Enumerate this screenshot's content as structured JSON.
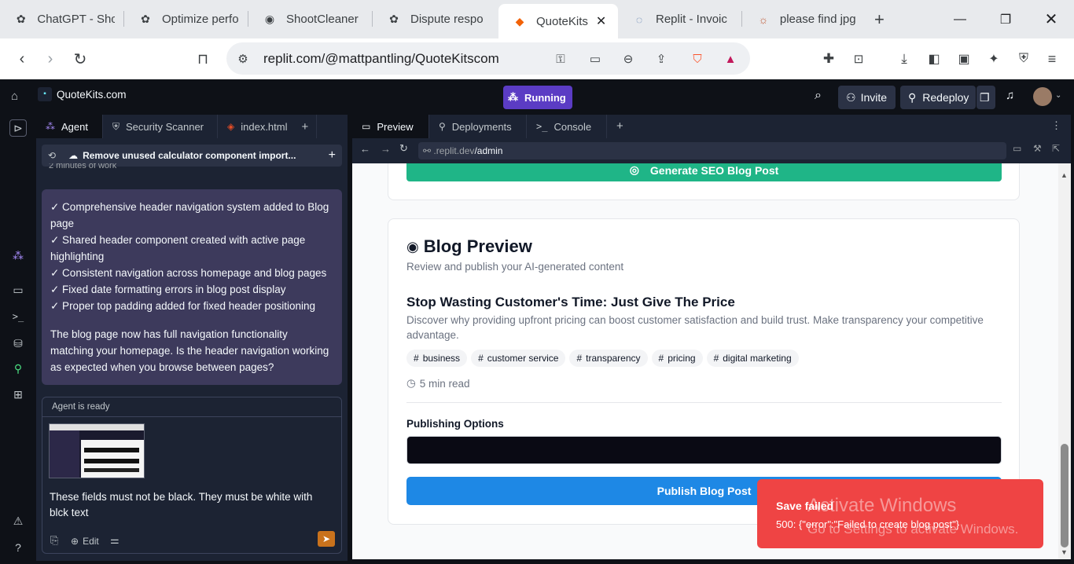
{
  "browser": {
    "tabs": [
      {
        "label": "ChatGPT - Sho",
        "icon": "openai-icon"
      },
      {
        "label": "Optimize perfo",
        "icon": "openai-icon"
      },
      {
        "label": "ShootCleaner",
        "icon": "shootcleaner-icon"
      },
      {
        "label": "Dispute respo",
        "icon": "openai-icon"
      },
      {
        "label": "QuoteKits",
        "icon": "replit-icon"
      },
      {
        "label": "Replit - Invoic",
        "icon": "loading-icon"
      },
      {
        "label": "please find jpg",
        "icon": "claude-icon"
      }
    ],
    "url": "replit.com/@mattpantling/QuoteKitscom"
  },
  "replit": {
    "project": "QuoteKits.com",
    "run_label": "Running",
    "invite": "Invite",
    "redeploy": "Redeploy"
  },
  "agent_tabs": [
    "Agent",
    "Security Scanner",
    "index.html"
  ],
  "agent": {
    "checkpoint": "Remove unused calculator component import...",
    "checkpoint_sub": "2 minutes of work",
    "bullets": [
      "✓ Comprehensive header navigation system added to Blog page",
      "✓ Shared header component created with active page highlighting",
      "✓ Consistent navigation across homepage and blog pages",
      "✓ Fixed date formatting errors in blog post display",
      "✓ Proper top padding added for fixed header positioning"
    ],
    "closing": "The blog page now has full navigation functionality matching your homepage. Is the header navigation working as expected when you browse between pages?",
    "status": "Agent is ready",
    "input": "These fields must not be black. They must be white with blck text",
    "edit": "Edit"
  },
  "right_tabs": [
    "Preview",
    "Deployments",
    "Console"
  ],
  "preview": {
    "url_prefix": ".replit.dev",
    "url_path": "/admin",
    "generate_btn": "Generate SEO Blog Post",
    "blog_title": "Blog Preview",
    "blog_sub": "Review and publish your AI-generated content",
    "post_title": "Stop Wasting Customer's Time: Just Give The Price",
    "post_desc": "Discover why providing upfront pricing can boost customer satisfaction and build trust. Make transparency your competitive advantage.",
    "tags": [
      "business",
      "customer service",
      "transparency",
      "pricing",
      "digital marketing"
    ],
    "read_time": "5 min read",
    "publishing_label": "Publishing Options",
    "publish_btn": "Publish Blog Post"
  },
  "toast": {
    "title": "Save failed",
    "body": "500: {\"error\":\"Failed to create blog post\"}"
  },
  "watermark": {
    "line1": "Activate Windows",
    "line2": "Go to Settings to activate Windows."
  },
  "colors": {
    "accent_purple": "#5b3cc4",
    "generate_green": "#1fb587",
    "publish_blue": "#1e88e5",
    "toast_red": "#ef4444",
    "dark_input": "#0a0a14"
  }
}
